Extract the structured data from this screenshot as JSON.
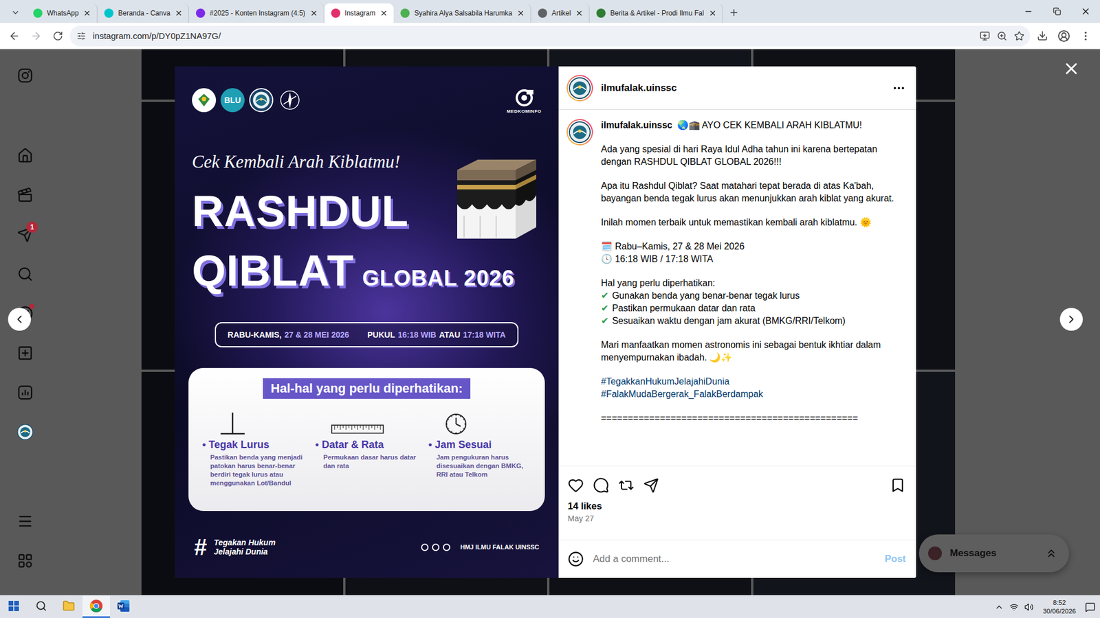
{
  "browser": {
    "tabs": [
      {
        "label": "WhatsApp",
        "selected": false,
        "color": "#25d366"
      },
      {
        "label": "Beranda - Canva",
        "selected": false,
        "color": "#00c4cc"
      },
      {
        "label": "#2025 - Konten Instagram (4:5)",
        "selected": false,
        "color": "#7d2ae8"
      },
      {
        "label": "Instagram",
        "selected": true,
        "color": "#e1306c"
      },
      {
        "label": "Syahira Alya Salsabila Harumka",
        "selected": false,
        "color": "#4caf50"
      },
      {
        "label": "Artikel",
        "selected": false,
        "color": "#5f6368"
      },
      {
        "label": "Berita & Artikel - Prodi Ilmu Fal",
        "selected": false,
        "color": "#2e7d32"
      }
    ],
    "url": "instagram.com/p/DY0pZ1NA97G/"
  },
  "nav": {
    "messages_badge": "1",
    "explore_dot": true
  },
  "post": {
    "author": "ilmufalak.uinssc",
    "headline": "🌏🕋 AYO CEK KEMBALI ARAH KIBLATMU!",
    "caption": [
      {
        "kind": "text",
        "lines": [
          "Ada yang spesial di hari Raya Idul Adha tahun ini karena bertepatan dengan RASHDUL QIBLAT GLOBAL 2026!!!"
        ]
      },
      {
        "kind": "text",
        "lines": [
          "Apa itu Rashdul Qiblat? Saat matahari tepat berada di atas Ka'bah, bayangan benda tegak lurus akan menunjukkan arah kiblat yang akurat."
        ]
      },
      {
        "kind": "text",
        "lines": [
          "Inilah momen terbaik untuk memastikan kembali arah kiblatmu. 🌞"
        ]
      },
      {
        "kind": "text",
        "lines": [
          "🗓️ Rabu–Kamis, 27 & 28 Mei 2026",
          "🕓 16:18 WIB / 17:18 WITA"
        ]
      },
      {
        "kind": "checklist",
        "title": "Hal yang perlu diperhatikan:",
        "items": [
          {
            "mark": "✔",
            "text": "Gunakan benda yang benar-benar tegak lurus"
          },
          {
            "mark": "✔",
            "text": "Pastikan permukaan datar dan rata"
          },
          {
            "mark": "✔",
            "text": "Sesuaikan waktu dengan jam akurat (BMKG/RRI/Telkom)"
          }
        ]
      },
      {
        "kind": "text",
        "lines": [
          "Mari manfaatkan momen astronomis ini sebagai bentuk ikhtiar dalam menyempurnakan ibadah. 🌙✨"
        ]
      },
      {
        "kind": "hashtags",
        "lines": [
          "#TegakkanHukumJelajahiDunia",
          "#FalakMudaBergerak_FalakBerdampak"
        ]
      },
      {
        "kind": "text",
        "lines": [
          "================================================"
        ]
      }
    ],
    "liked": false,
    "saved": false,
    "likes": "14 likes",
    "date": "May 27",
    "comment_placeholder": "Add a comment...",
    "post_button": "Post"
  },
  "poster": {
    "blu_label": "BLU",
    "media_label": "MEDKOMINFO",
    "tagline": "Cek Kembali Arah Kiblatmu!",
    "title_top": "RASHDUL",
    "title_bottom": "QIBLAT",
    "title_suffix": "GLOBAL 2026",
    "pill_groups": [
      [
        {
          "text": "RABU-KAMIS,",
          "highlight": false
        },
        {
          "text": "27 & 28 MEI 2026",
          "highlight": true
        }
      ],
      [
        {
          "text": "PUKUL",
          "highlight": false
        },
        {
          "text": "16:18 WIB",
          "highlight": true
        },
        {
          "text": "ATAU",
          "highlight": false
        },
        {
          "text": "17:18 WITA",
          "highlight": true
        }
      ]
    ],
    "checklist_title": "Hal-hal yang perlu diperhatikan:",
    "bullet": "•",
    "items": [
      {
        "kind": "stick",
        "title": "Tegak Lurus",
        "text": "Pastikan benda yang menjadi patokan harus benar-benar berdiri tegak lurus atau menggunakan Lot/Bandul"
      },
      {
        "kind": "ruler",
        "title": "Datar & Rata",
        "text": "Permukaan dasar harus datar dan rata"
      },
      {
        "kind": "clock",
        "title": "Jam Sesuai",
        "text": "Jam pengukuran harus disesuaikan dengan BMKG, RRI atau Telkom"
      }
    ],
    "hash": "#",
    "motto": [
      "Tegakan Hukum",
      "Jelajahi Dunia"
    ],
    "org": "HMJ ILMU FALAK UINSSC"
  },
  "messages": {
    "label": "Messages"
  },
  "taskbar": {
    "time": "8:52",
    "date": "30/06/2026"
  }
}
